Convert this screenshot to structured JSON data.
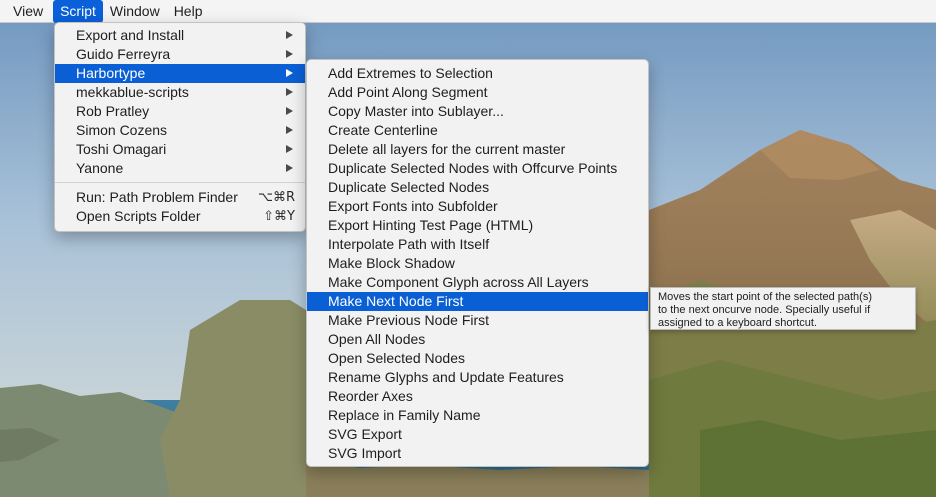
{
  "menubar": {
    "items": [
      {
        "label": "View"
      },
      {
        "label": "Script",
        "active": true
      },
      {
        "label": "Window"
      },
      {
        "label": "Help"
      }
    ],
    "highlight_color": "#0a60d8"
  },
  "script_menu": {
    "items": [
      {
        "label": "Export and Install",
        "submenu": true
      },
      {
        "label": "Guido Ferreyra",
        "submenu": true
      },
      {
        "label": "Harbortype",
        "submenu": true,
        "highlighted": true
      },
      {
        "label": "mekkablue-scripts",
        "submenu": true
      },
      {
        "label": "Rob Pratley",
        "submenu": true
      },
      {
        "label": "Simon Cozens",
        "submenu": true
      },
      {
        "label": "Toshi Omagari",
        "submenu": true
      },
      {
        "label": "Yanone",
        "submenu": true
      }
    ],
    "actions": [
      {
        "label": "Run: Path Problem Finder",
        "shortcut": "⌥⌘R"
      },
      {
        "label": "Open Scripts Folder",
        "shortcut": "⇧⌘Y"
      }
    ]
  },
  "harbortype_submenu": {
    "items": [
      {
        "label": "Add Extremes to Selection"
      },
      {
        "label": "Add Point Along Segment"
      },
      {
        "label": "Copy Master into Sublayer..."
      },
      {
        "label": "Create Centerline"
      },
      {
        "label": "Delete all layers for the current master"
      },
      {
        "label": "Duplicate Selected Nodes with Offcurve Points"
      },
      {
        "label": "Duplicate Selected Nodes"
      },
      {
        "label": "Export Fonts into Subfolder"
      },
      {
        "label": "Export Hinting Test Page (HTML)"
      },
      {
        "label": "Interpolate Path with Itself"
      },
      {
        "label": "Make Block Shadow"
      },
      {
        "label": "Make Component Glyph across All Layers"
      },
      {
        "label": "Make Next Node First",
        "highlighted": true
      },
      {
        "label": "Make Previous Node First"
      },
      {
        "label": "Open All Nodes"
      },
      {
        "label": "Open Selected Nodes"
      },
      {
        "label": "Rename Glyphs and Update Features"
      },
      {
        "label": "Reorder Axes"
      },
      {
        "label": "Replace in Family Name"
      },
      {
        "label": "SVG Export"
      },
      {
        "label": "SVG Import"
      }
    ]
  },
  "tooltip": {
    "lines": [
      "Moves the start point of the selected  path(s)",
      "to the next oncurve node. Specially useful if",
      "assigned to a keyboard shortcut."
    ]
  }
}
